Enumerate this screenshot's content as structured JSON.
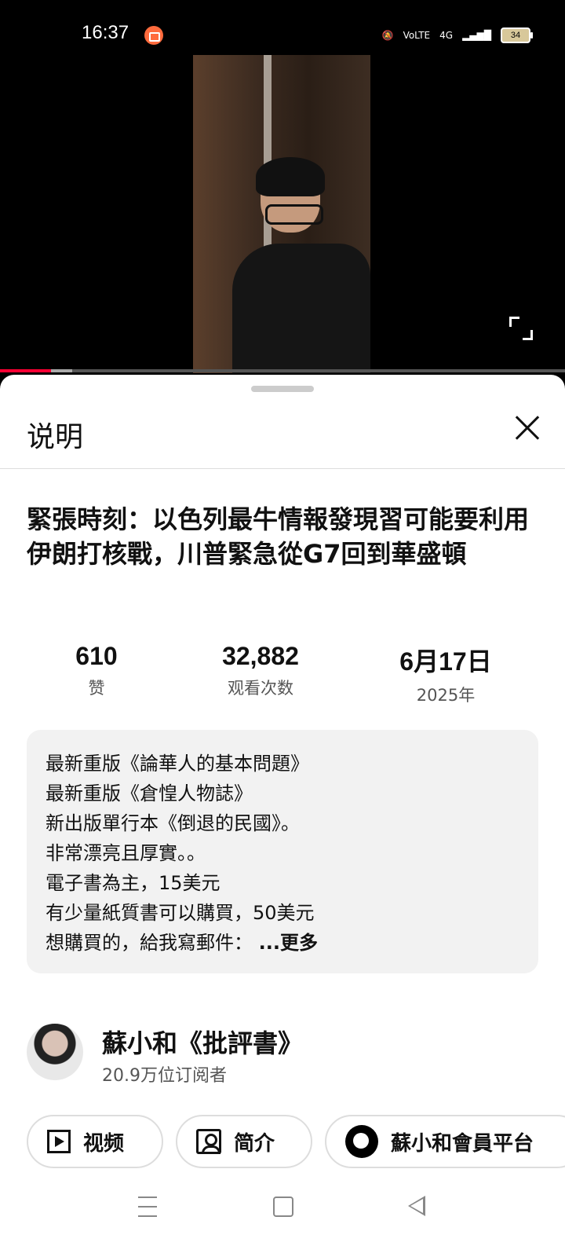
{
  "status_bar": {
    "time": "16:37",
    "battery": "34",
    "network": "4G"
  },
  "player": {
    "progress_percent": 9
  },
  "panel": {
    "header_title": "说明",
    "video_title": "緊張時刻：以色列最牛情報發現習可能要利用伊朗打核戰，川普緊急從G7回到華盛頓",
    "stats": [
      {
        "value": "610",
        "label": "赞"
      },
      {
        "value": "32,882",
        "label": "观看次数"
      },
      {
        "value": "6月17日",
        "label": "2025年"
      }
    ],
    "description_lines": [
      "最新重版《論華人的基本問題》",
      "最新重版《倉惶人物誌》",
      "新出版單行本《倒退的民國》。",
      "非常漂亮且厚實。。",
      "電子書為主，15美元",
      "有少量紙質書可以購買，50美元",
      "想購買的，給我寫郵件："
    ],
    "more_label": "...更多",
    "channel": {
      "name": "蘇小和《批評書》",
      "subscribers": "20.9万位订阅者"
    },
    "pills": [
      {
        "label": "视频",
        "icon": "play-icon"
      },
      {
        "label": "简介",
        "icon": "person-icon"
      },
      {
        "label": "蘇小和會員平台",
        "icon": "patreon-icon"
      }
    ]
  }
}
